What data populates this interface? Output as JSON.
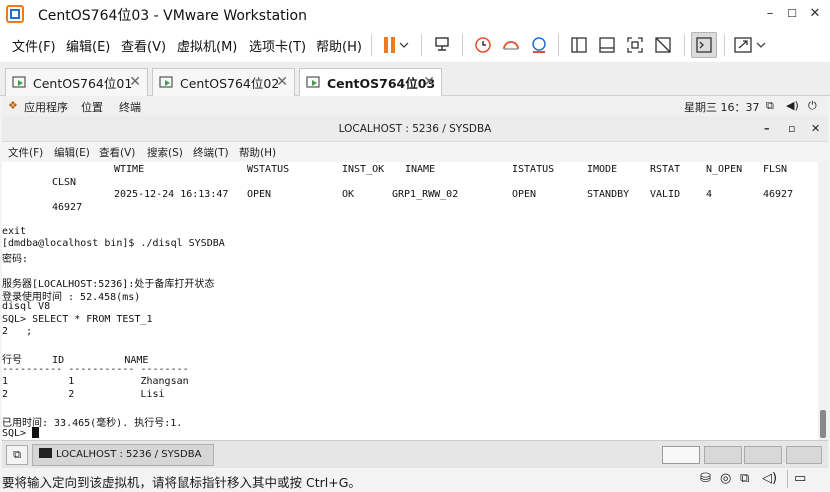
{
  "window": {
    "title": "CentOS764位03 - VMware Workstation",
    "minimize": "–",
    "maximize": "☐",
    "close": "✕"
  },
  "menu": {
    "items": [
      "文件(F)",
      "编辑(E)",
      "查看(V)",
      "虚拟机(M)",
      "选项卡(T)",
      "帮助(H)"
    ]
  },
  "tabs": [
    {
      "label": "CentOS764位01",
      "active": false
    },
    {
      "label": "CentOS764位02",
      "active": false
    },
    {
      "label": "CentOS764位03",
      "active": true
    }
  ],
  "guest_bar": {
    "apps": "应用程序",
    "places": "位置",
    "terminal": "终端",
    "clock": "星期三 16：37"
  },
  "terminal": {
    "title": "LOCALHOST : 5236 / SYSDBA",
    "menu": [
      "文件(F)",
      "编辑(E)",
      "查看(V)",
      "搜索(S)",
      "终端(T)",
      "帮助(H)"
    ],
    "header_row": [
      "WTIME",
      "WSTATUS",
      "INST_OK",
      "INAME",
      "ISTATUS",
      "IMODE",
      "RSTAT",
      "N_OPEN",
      "FLSN"
    ],
    "header_row2": "CLSN",
    "data_row": [
      "2025-12-24 16:13:47",
      "OPEN",
      "OK",
      "GRP1_RWW_02",
      "OPEN",
      "STANDBY",
      "VALID",
      "4",
      "46927"
    ],
    "data_row2": "46927",
    "lines": [
      "exit",
      "[dmdba@localhost bin]$ ./disql SYSDBA",
      "密码:",
      "",
      "服务器[LOCALHOST:5236]:处于备库打开状态",
      "登录使用时间 : 52.458(ms)",
      "disql V8",
      "SQL> SELECT * FROM TEST_1",
      "2   ;",
      "",
      "行号     ID          NAME",
      "---------- ----------- --------",
      "1          1           Zhangsan",
      "2          2           Lisi",
      "",
      "已用时间: 33.465(毫秒). 执行号:1.",
      "SQL> "
    ]
  },
  "guest_taskbar": {
    "task_label": "LOCALHOST : 5236 / SYSDBA"
  },
  "statusbar": {
    "message": "要将输入定向到该虚拟机，请将鼠标指针移入其中或按 Ctrl+G。"
  },
  "colors": {
    "accent_orange": "#f07a1a",
    "tab_icon_green": "#3aa24a",
    "ctrl_red": "#e0502a",
    "ctrl_blue": "#1f6fd1"
  }
}
